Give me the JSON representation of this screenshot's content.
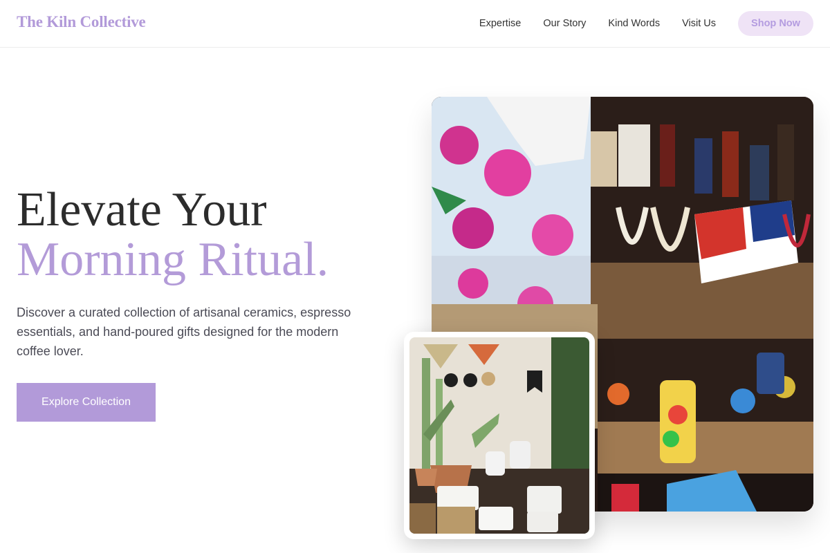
{
  "header": {
    "brand": "The Kiln Collective",
    "nav": [
      "Expertise",
      "Our Story",
      "Kind Words",
      "Visit Us"
    ],
    "shop_label": "Shop Now"
  },
  "hero": {
    "title_line1": "Elevate Your",
    "title_line2": "Morning Ritual.",
    "description": "Discover a curated collection of artisanal ceramics, espresso essentials, and hand-poured gifts designed for the modern coffee lover.",
    "cta_label": "Explore Collection"
  },
  "images": {
    "main_alt": "Colorful market stall with textiles, beaded necklaces and bottles",
    "inset_alt": "Boutique shelf with potted plants, mugs and ceramic planters"
  },
  "colors": {
    "accent": "#b29ad9",
    "shop_bg": "#efe3f6",
    "text_dark": "#2c2c2c"
  }
}
